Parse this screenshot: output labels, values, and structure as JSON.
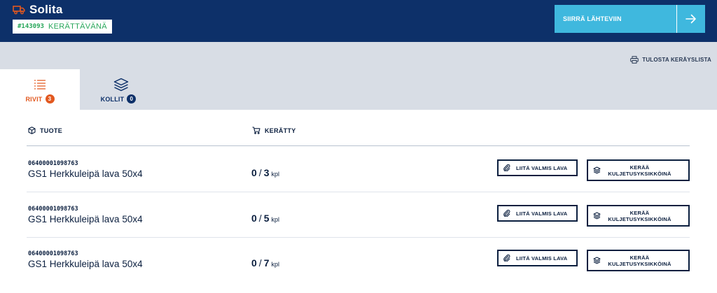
{
  "header": {
    "brand": "Solita",
    "order_id": "#143093",
    "order_status": "KERÄTTÄVÄNÄ",
    "send_button": "SIIRRÄ LÄHTEVIIN",
    "colors": {
      "header_bg": "#0d3069",
      "accent": "#3fb8de",
      "status": "#27a65a",
      "orange": "#e2581f"
    }
  },
  "toolbar": {
    "print_label": "TULOSTA KERÄYSLISTA"
  },
  "tabs": [
    {
      "label": "RIVIT",
      "count": "3",
      "icon": "list-icon",
      "active": true
    },
    {
      "label": "KOLLIT",
      "count": "0",
      "icon": "layers-icon",
      "active": false
    }
  ],
  "table": {
    "headers": {
      "product": "TUOTE",
      "collected": "KERÄTTY"
    },
    "rows": [
      {
        "ean": "06400001098763",
        "name": "GS1 Herkkuleipä lava 50x4",
        "done": "0",
        "total": "3",
        "unit": "kpl"
      },
      {
        "ean": "06400001098763",
        "name": "GS1 Herkkuleipä lava 50x4",
        "done": "0",
        "total": "5",
        "unit": "kpl"
      },
      {
        "ean": "06400001098763",
        "name": "GS1 Herkkuleipä lava 50x4",
        "done": "0",
        "total": "7",
        "unit": "kpl"
      }
    ],
    "attach_label": "LIITÄ VALMIS LAVA",
    "collect_label_line1": "KERÄÄ",
    "collect_label_line2": "KULJETUSYKSIKKÖINÄ"
  }
}
